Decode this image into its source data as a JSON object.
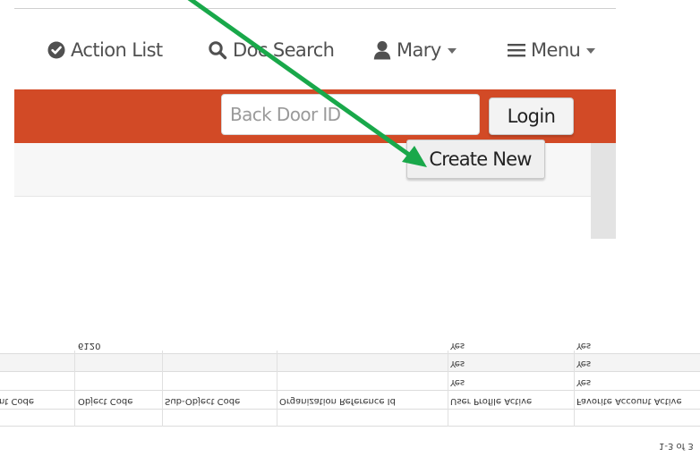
{
  "nav": {
    "action_list": {
      "label": "Action List",
      "icon": "check-circle-icon"
    },
    "doc_search": {
      "label": "Doc Search",
      "icon": "search-icon"
    },
    "user": {
      "label": "Mary",
      "icon": "user-icon"
    },
    "menu": {
      "label": "Menu",
      "icon": "hamburger-icon"
    }
  },
  "login_bar": {
    "backdoor_placeholder": "Back Door ID",
    "login_label": "Login"
  },
  "toolbar": {
    "create_new_label": "Create New"
  },
  "table": {
    "columns": [
      "Account Code",
      "Object Code",
      "Sub-Object Code",
      "Organization Reference Id",
      "User Profile Active",
      "Favorite Account Active"
    ],
    "visible_headers": {
      "account_code_fragment": "nt Code",
      "object_code": "Object Code",
      "sub_object_code": "Sub-Object Code",
      "org_ref_id": "Organization Reference Id",
      "user_profile_active": "User Profile Active",
      "favorite_account_active": "Favorite Account Active"
    },
    "rows": [
      {
        "object_code": "",
        "user_profile_active": "Yes",
        "favorite_account_active": "Yes"
      },
      {
        "object_code": "",
        "user_profile_active": "Yes",
        "favorite_account_active": "Yes"
      },
      {
        "object_code": "6120",
        "user_profile_active": "Yes",
        "favorite_account_active": "Yes"
      }
    ],
    "pager": "1-3 of 3"
  },
  "colors": {
    "bar": "#d24a26",
    "pointer_arrow": "#19a84a"
  }
}
